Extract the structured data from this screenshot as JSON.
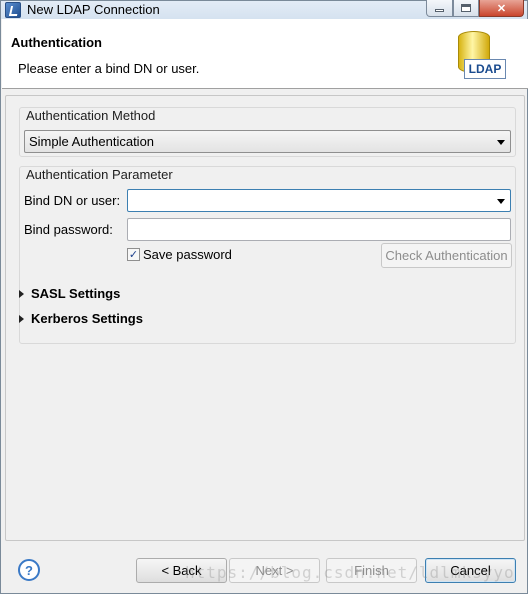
{
  "window": {
    "title": "New LDAP Connection",
    "icon": "eclipse-app-icon",
    "controls": {
      "minimize": "minimize-icon",
      "maximize": "maximize-icon",
      "close": "close-icon"
    }
  },
  "banner": {
    "title": "Authentication",
    "description": "Please enter a bind DN or user.",
    "icon_label": "LDAP"
  },
  "method_group": {
    "label": "Authentication Method",
    "selected": "Simple Authentication"
  },
  "param_group": {
    "label": "Authentication Parameter",
    "bind_dn_label": "Bind DN or user:",
    "bind_dn_value": "",
    "bind_password_label": "Bind password:",
    "bind_password_value": "",
    "save_password_label": "Save password",
    "save_password_checked": true,
    "check_button_label": "Check Authentication"
  },
  "sections": [
    {
      "label": "SASL Settings",
      "expanded": false
    },
    {
      "label": "Kerberos Settings",
      "expanded": false
    }
  ],
  "footer": {
    "help_symbol": "?",
    "back_label": "< Back",
    "next_label": "Next >",
    "finish_label": "Finish",
    "cancel_label": "Cancel"
  },
  "watermark": "https://blog.csdn.net/ldlmksyyo"
}
